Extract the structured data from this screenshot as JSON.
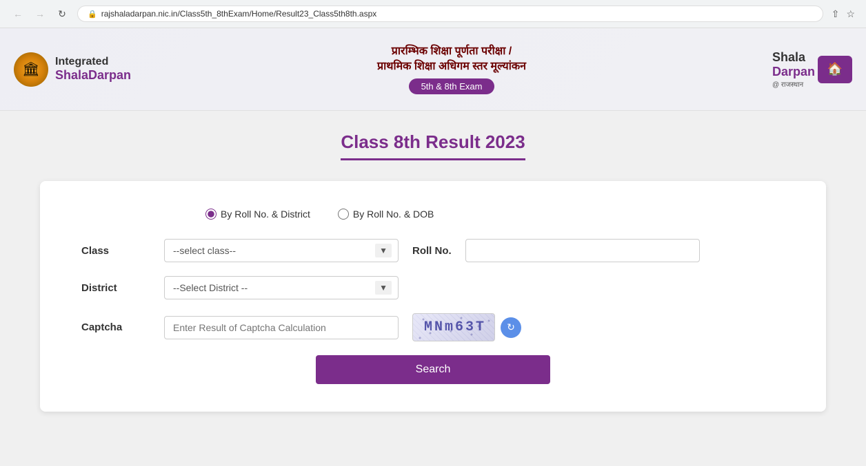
{
  "browser": {
    "url": "rajshaladarpan.nic.in/Class5th_8thExam/Home/Result23_Class5th8th.aspx"
  },
  "header": {
    "logo_text1": "Integrated",
    "logo_text2": "ShalaDarpan",
    "hindi_line1": "प्रारम्भिक शिक्षा पूर्णता परीक्षा /",
    "hindi_line2": "प्राथमिक शिक्षा अधिगम स्तर मूल्यांकन",
    "exam_badge": "5th & 8th  Exam",
    "right_logo1": "Shala",
    "right_logo2": "Darpan",
    "right_logo_sub": "@ राजस्थान"
  },
  "page": {
    "title": "Class 8th Result 2023"
  },
  "form": {
    "radio1_label": "By Roll No. & District",
    "radio2_label": "By Roll No. & DOB",
    "class_label": "Class",
    "class_placeholder": "--select class--",
    "district_label": "District",
    "district_placeholder": "--Select District --",
    "rollno_label": "Roll No.",
    "captcha_label": "Captcha",
    "captcha_placeholder": "Enter Result of Captcha Calculation",
    "captcha_text": "MNm63T",
    "search_button": "Search"
  }
}
